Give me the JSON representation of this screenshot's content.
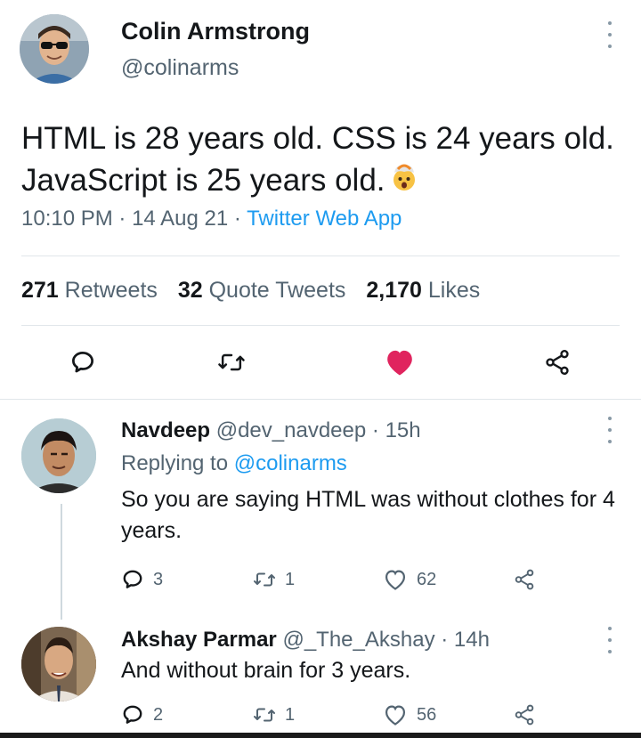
{
  "main_tweet": {
    "author_name": "Colin Armstrong",
    "author_handle": "@colinarms",
    "text": "HTML is 28 years old. CSS is 24 years old. JavaScript is 25 years old.",
    "emoji": "exploding-head-emoji",
    "time": "10:10 PM",
    "date": "14 Aug 21",
    "separator": "·",
    "source": "Twitter Web App",
    "stats": {
      "retweets_count": "271",
      "retweets_label": "Retweets",
      "quotes_count": "32",
      "quotes_label": "Quote Tweets",
      "likes_count": "2,170",
      "likes_label": "Likes"
    },
    "liked": true,
    "like_color": "#e0245e"
  },
  "replies": [
    {
      "author_name": "Navdeep",
      "author_handle": "@dev_navdeep",
      "separator": "·",
      "time_ago": "15h",
      "replying_label": "Replying to",
      "replying_to": "@colinarms",
      "text": "So you are saying HTML was without clothes for 4 years.",
      "reply_count": "3",
      "retweet_count": "1",
      "like_count": "62"
    },
    {
      "author_name": "Akshay Parmar",
      "author_handle": "@_The_Akshay",
      "separator": "·",
      "time_ago": "14h",
      "text": "And without brain for 3 years.",
      "reply_count": "2",
      "retweet_count": "1",
      "like_count": "56"
    }
  ],
  "colors": {
    "text_primary": "#14171a",
    "text_secondary": "#536471",
    "link": "#1d9bf0",
    "divider": "#e1e6ea"
  }
}
